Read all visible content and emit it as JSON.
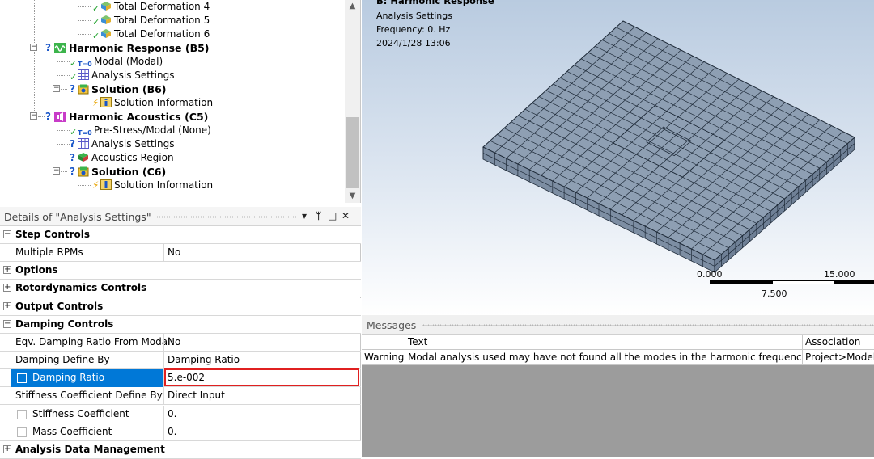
{
  "tree": {
    "items": [
      {
        "label": "Total Deformation 4"
      },
      {
        "label": "Total Deformation 5"
      },
      {
        "label": "Total Deformation 6"
      },
      {
        "label": "Harmonic Response (B5)"
      },
      {
        "label": "Modal (Modal)"
      },
      {
        "label": "Analysis Settings"
      },
      {
        "label": "Solution (B6)"
      },
      {
        "label": "Solution Information"
      },
      {
        "label": "Harmonic Acoustics (C5)"
      },
      {
        "label": "Pre-Stress/Modal (None)"
      },
      {
        "label": "Analysis Settings"
      },
      {
        "label": "Acoustics Region"
      },
      {
        "label": "Solution (C6)"
      },
      {
        "label": "Solution Information"
      }
    ],
    "icon_text": {
      "t0": "T=0"
    }
  },
  "details": {
    "title": "Details of \"Analysis Settings\"",
    "controls": {
      "dropdown": "▾",
      "pin": "ᛘ",
      "maximize": "□",
      "close": "✕"
    },
    "rows": [
      {
        "name": "Step Controls",
        "value": "",
        "kind": "section",
        "expanded": true
      },
      {
        "name": "Multiple RPMs",
        "value": "No",
        "kind": "field"
      },
      {
        "name": "Options",
        "value": "",
        "kind": "section",
        "expanded": false
      },
      {
        "name": "Rotordynamics Controls",
        "value": "",
        "kind": "section",
        "expanded": false
      },
      {
        "name": "Output Controls",
        "value": "",
        "kind": "section",
        "expanded": false
      },
      {
        "name": "Damping Controls",
        "value": "",
        "kind": "section",
        "expanded": true
      },
      {
        "name": "Eqv. Damping Ratio From Modal",
        "value": "No",
        "kind": "field"
      },
      {
        "name": "Damping Define By",
        "value": "Damping Ratio",
        "kind": "field"
      },
      {
        "name": "Damping Ratio",
        "value": "5.e-002",
        "kind": "param",
        "selected": true
      },
      {
        "name": "Stiffness Coefficient Define By",
        "value": "Direct Input",
        "kind": "field"
      },
      {
        "name": "Stiffness Coefficient",
        "value": "0.",
        "kind": "param"
      },
      {
        "name": "Mass Coefficient",
        "value": "0.",
        "kind": "param"
      },
      {
        "name": "Analysis Data Management",
        "value": "",
        "kind": "section",
        "expanded": false
      }
    ]
  },
  "viewport": {
    "title": "B: Harmonic Response",
    "subtitle": "Analysis Settings",
    "frequency": "Frequency: 0. Hz",
    "date": "2024/1/28 13:06",
    "scale": {
      "left": "0.000",
      "mid": "7.500",
      "right": "15.000"
    }
  },
  "messages": {
    "title": "Messages",
    "columns": [
      "",
      "Text",
      "Association"
    ],
    "rows": [
      {
        "type": "Warning",
        "text": "Modal analysis used may have not found all the modes in the harmonic frequency swee",
        "association": "Project>Model"
      }
    ]
  },
  "colors": {
    "selection": "#0078d7",
    "highlight_border": "#e02020",
    "mesh_face": "#8e9fb3",
    "mesh_line": "#1e2a38"
  }
}
